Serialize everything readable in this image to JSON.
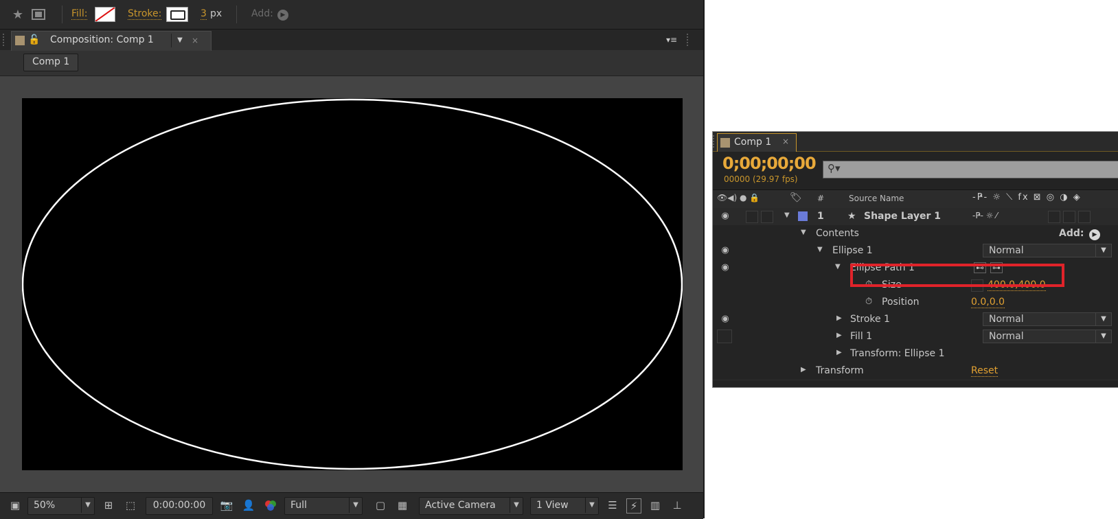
{
  "toolbar": {
    "fill_label": "Fill:",
    "stroke_label": "Stroke:",
    "stroke_width_value": "3",
    "stroke_width_unit": "px",
    "add_label": "Add:"
  },
  "composition_panel": {
    "tab_title": "Composition: Comp 1",
    "breadcrumb": "Comp 1",
    "shape": "ellipse",
    "stroke_color": "#ffffff",
    "canvas_color": "#000000"
  },
  "viewer_controls": {
    "zoom": "50%",
    "timecode": "0:00:00:00",
    "resolution": "Full",
    "camera": "Active Camera",
    "views": "1 View"
  },
  "timeline": {
    "tab_title": "Comp 1",
    "current_time": "0;00;00;00",
    "frame_info": "00000 (29.97 fps)",
    "header": {
      "num_col": "#",
      "source_name_col": "Source Name"
    },
    "layer": {
      "number": "1",
      "name": "Shape Layer 1",
      "label_color": "#6a7bd8"
    },
    "rows": {
      "contents": "Contents",
      "add": "Add:",
      "ellipse_group": "Ellipse 1",
      "ellipse_mode": "Normal",
      "ellipse_path": "Ellipse Path 1",
      "size_label": "Size",
      "size_value": "400.0,400.0",
      "position_label": "Position",
      "position_value": "0.0,0.0",
      "stroke": "Stroke 1",
      "stroke_mode": "Normal",
      "fill": "Fill 1",
      "fill_mode": "Normal",
      "transform_ellipse": "Transform: Ellipse 1",
      "transform": "Transform",
      "reset": "Reset"
    },
    "highlight_color": "#e0232a"
  }
}
